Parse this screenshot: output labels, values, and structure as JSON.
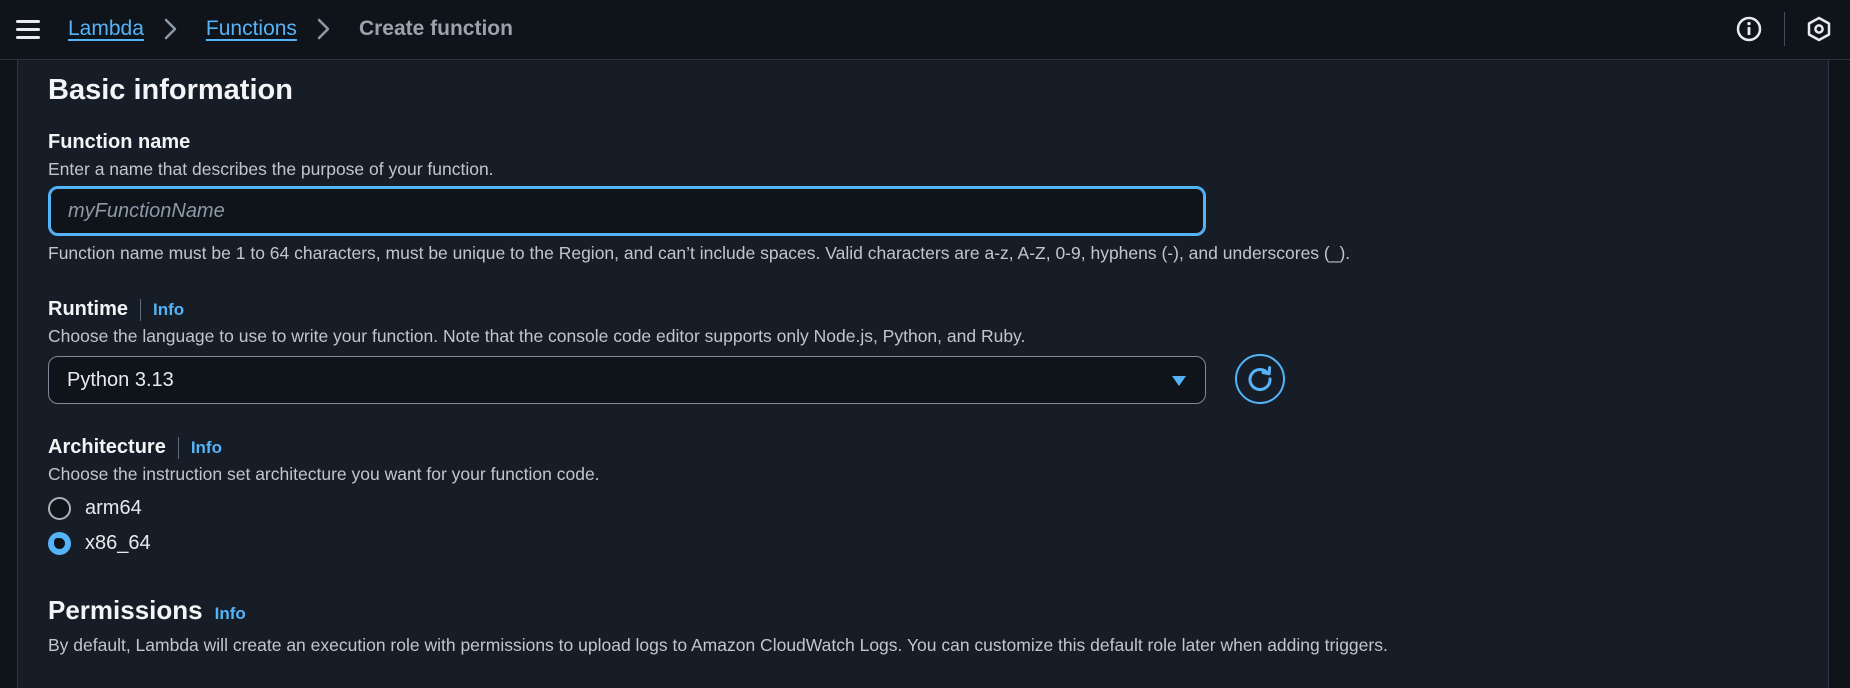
{
  "breadcrumb": {
    "items": [
      "Lambda",
      "Functions"
    ],
    "current": "Create function"
  },
  "section": {
    "title": "Basic information"
  },
  "function_name": {
    "label": "Function name",
    "description": "Enter a name that describes the purpose of your function.",
    "placeholder": "myFunctionName",
    "value": "",
    "constraint": "Function name must be 1 to 64 characters, must be unique to the Region, and can’t include spaces. Valid characters are a-z, A-Z, 0-9, hyphens (-), and underscores (_)."
  },
  "runtime": {
    "label": "Runtime",
    "info": "Info",
    "description": "Choose the language to use to write your function. Note that the console code editor supports only Node.js, Python, and Ruby.",
    "selected": "Python 3.13"
  },
  "architecture": {
    "label": "Architecture",
    "info": "Info",
    "description": "Choose the instruction set architecture you want for your function code.",
    "options": [
      {
        "label": "arm64",
        "checked": false
      },
      {
        "label": "x86_64",
        "checked": true
      }
    ]
  },
  "permissions": {
    "title": "Permissions",
    "info": "Info",
    "description": "By default, Lambda will create an execution role with permissions to upload logs to Amazon CloudWatch Logs. You can customize this default role later when adding triggers."
  },
  "icons": {
    "menu": "hamburger-menu-icon",
    "info": "info-circle-icon",
    "settings": "settings-hexagon-icon",
    "refresh": "refresh-icon",
    "caret": "caret-down-icon",
    "separator": "chevron-right-icon"
  },
  "colors": {
    "accent": "#55b4f8",
    "background": "#0f141a",
    "panel": "#161d26"
  }
}
